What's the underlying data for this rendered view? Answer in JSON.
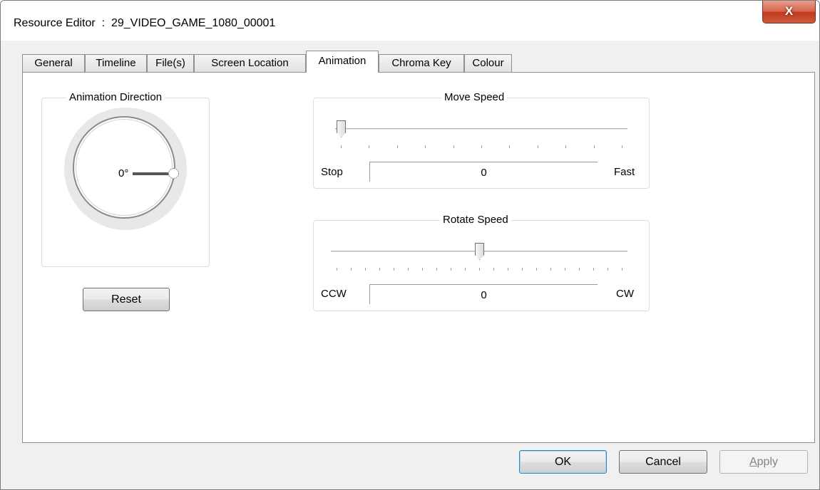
{
  "window": {
    "title": "Resource Editor  :  29_VIDEO_GAME_1080_00001",
    "close_glyph": "X"
  },
  "tabs": [
    {
      "label": "General",
      "active": false
    },
    {
      "label": "Timeline",
      "active": false
    },
    {
      "label": "File(s)",
      "active": false
    },
    {
      "label": "Screen Location",
      "active": false
    },
    {
      "label": "Animation",
      "active": true
    },
    {
      "label": "Chroma Key",
      "active": false
    },
    {
      "label": "Colour",
      "active": false
    }
  ],
  "animation_direction": {
    "group_label": "Animation Direction",
    "angle_label": "0°",
    "angle_degrees": 0,
    "reset_label": "Reset"
  },
  "move_speed": {
    "group_label": "Move Speed",
    "min_label": "Stop",
    "max_label": "Fast",
    "value": "0",
    "slider_fraction": 0.0,
    "tick_count": 11
  },
  "rotate_speed": {
    "group_label": "Rotate Speed",
    "min_label": "CCW",
    "max_label": "CW",
    "value": "0",
    "slider_fraction": 0.5,
    "tick_count": 21
  },
  "footer": {
    "ok_label": "OK",
    "cancel_label": "Cancel",
    "apply_label_first": "A",
    "apply_label_rest": "pply"
  },
  "colors": {
    "close_button": "#c7432a",
    "default_button_border": "#3c7fb1",
    "disabled_text": "#838383"
  }
}
